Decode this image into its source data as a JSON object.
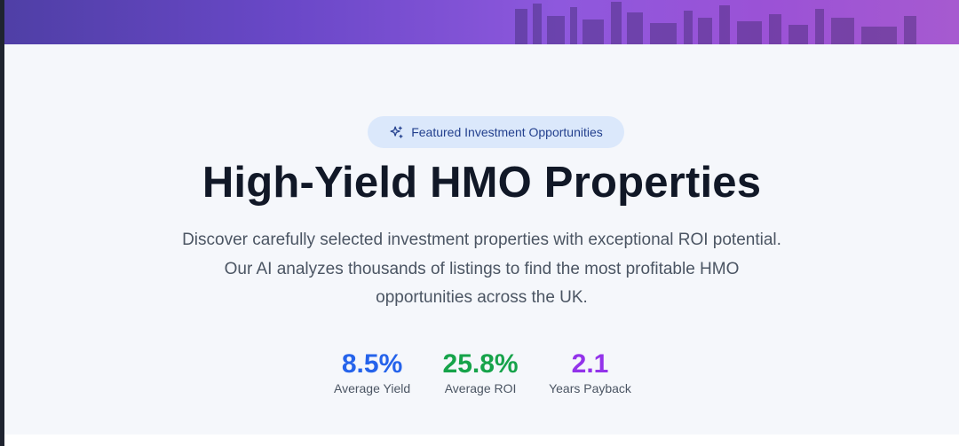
{
  "badge": {
    "icon": "sparkles-icon",
    "label": "Featured Investment Opportunities"
  },
  "title": "High-Yield HMO Properties",
  "subtitle": {
    "line1": "Discover carefully selected investment properties with exceptional ROI potential.",
    "line2": "Our AI analyzes thousands of listings to find the most profitable HMO",
    "line3": "opportunities across the UK."
  },
  "stats": [
    {
      "value": "8.5%",
      "label": "Average Yield",
      "color": "#2563eb"
    },
    {
      "value": "25.8%",
      "label": "Average ROI",
      "color": "#16a34a"
    },
    {
      "value": "2.1",
      "label": "Years Payback",
      "color": "#9333ea"
    }
  ],
  "colors": {
    "banner_start": "#4f3fa6",
    "banner_end": "#a65ad0",
    "content_bg": "#f5f7fb",
    "badge_bg": "#dbe8fb",
    "badge_text": "#23408e",
    "title": "#111827",
    "body_text": "#4b5563"
  }
}
